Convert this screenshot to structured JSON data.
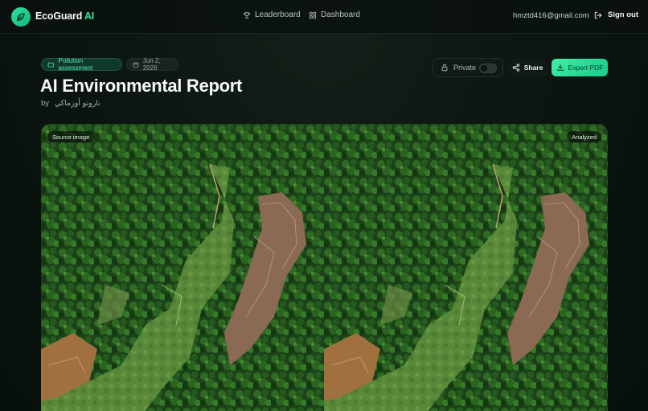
{
  "header": {
    "brand_name": "EcoGuard",
    "brand_accent": "AI",
    "nav": [
      {
        "label": "Leaderboard",
        "icon": "trophy-icon"
      },
      {
        "label": "Dashboard",
        "icon": "grid-icon"
      }
    ],
    "user_email": "hmztd416@gmail.com",
    "signout_label": "Sign out"
  },
  "report": {
    "category": "Pollution assessment",
    "date": "Jun 2, 2026",
    "title": "AI Environmental Report",
    "by_label": "by",
    "author": "ناروتو أوزماكي"
  },
  "controls": {
    "private_label": "Private",
    "private_enabled": false,
    "share_label": "Share",
    "export_label": "Export PDF"
  },
  "images": {
    "source_label": "Source image",
    "analyzed_label": "Analyzed"
  },
  "colors": {
    "accent": "#3be3a0",
    "background": "#0a120f",
    "export_button": "#2ee39a"
  }
}
